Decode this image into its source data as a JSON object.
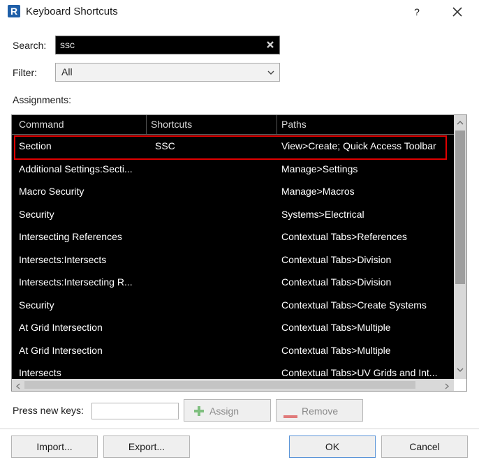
{
  "window": {
    "title": "Keyboard Shortcuts",
    "help_glyph": "?",
    "app_icon_letter": "R"
  },
  "search": {
    "label": "Search:",
    "value": "ssc"
  },
  "filter": {
    "label": "Filter:",
    "value": "All"
  },
  "assignments": {
    "label": "Assignments:",
    "columns": [
      "Command",
      "Shortcuts",
      "Paths"
    ],
    "rows": [
      {
        "command": "Section",
        "shortcut": "SSC",
        "path": "View>Create; Quick Access Toolbar"
      },
      {
        "command": "Additional Settings:Secti...",
        "shortcut": "",
        "path": "Manage>Settings"
      },
      {
        "command": "Macro Security",
        "shortcut": "",
        "path": "Manage>Macros"
      },
      {
        "command": "Security",
        "shortcut": "",
        "path": "Systems>Electrical"
      },
      {
        "command": "Intersecting References",
        "shortcut": "",
        "path": "Contextual Tabs>References"
      },
      {
        "command": "Intersects:Intersects",
        "shortcut": "",
        "path": "Contextual Tabs>Division"
      },
      {
        "command": "Intersects:Intersecting R...",
        "shortcut": "",
        "path": "Contextual Tabs>Division"
      },
      {
        "command": "Security",
        "shortcut": "",
        "path": "Contextual Tabs>Create Systems"
      },
      {
        "command": "At Grid Intersection",
        "shortcut": "",
        "path": "Contextual Tabs>Multiple"
      },
      {
        "command": "At Grid Intersection",
        "shortcut": "",
        "path": "Contextual Tabs>Multiple"
      },
      {
        "command": "Intersects",
        "shortcut": "",
        "path": "Contextual Tabs>UV Grids and Int..."
      }
    ],
    "selected_index": 0
  },
  "press_keys": {
    "label": "Press new keys:",
    "value": ""
  },
  "buttons": {
    "assign": "Assign",
    "remove": "Remove",
    "import": "Import...",
    "export": "Export...",
    "ok": "OK",
    "cancel": "Cancel"
  },
  "colors": {
    "highlight_border": "#e00000",
    "ok_border": "#5b95d8",
    "assign_icon": "#7fbf7f",
    "remove_icon": "#e07a7a"
  }
}
